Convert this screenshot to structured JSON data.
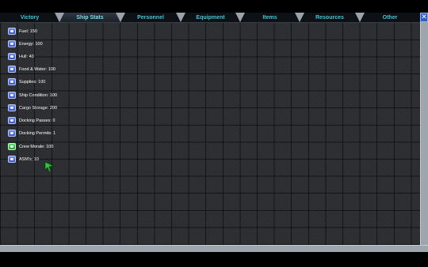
{
  "tabs": [
    {
      "label": "Victory",
      "active": false
    },
    {
      "label": "Ship Stats",
      "active": true
    },
    {
      "label": "Personnel",
      "active": false
    },
    {
      "label": "Equipment",
      "active": false
    },
    {
      "label": "Items",
      "active": false
    },
    {
      "label": "Resources",
      "active": false
    },
    {
      "label": "Other",
      "active": false
    }
  ],
  "close_icon": "close-x-icon",
  "stats": [
    {
      "label": "Fuel: 150",
      "icon": "fuel-icon"
    },
    {
      "label": "Energy: 100",
      "icon": "energy-icon"
    },
    {
      "label": "Hull: 40",
      "icon": "hull-icon"
    },
    {
      "label": "Food & Water: 100",
      "icon": "food-water-icon"
    },
    {
      "label": "Supplies: 100",
      "icon": "supplies-icon"
    },
    {
      "label": "Ship Condition: 100",
      "icon": "ship-condition-icon"
    },
    {
      "label": "Cargo Storage: 200",
      "icon": "cargo-storage-icon"
    },
    {
      "label": "Docking Passes: 0",
      "icon": "docking-pass-icon"
    },
    {
      "label": "Docking Permits: 1",
      "icon": "docking-permit-icon"
    },
    {
      "label": "Crew Morale: 100",
      "icon": "crew-morale-icon"
    },
    {
      "label": "ASM's: 10",
      "icon": "asm-icon"
    }
  ],
  "colors": {
    "tab_text": "#46c8dc",
    "icon_blue": "#4b6be0",
    "icon_green": "#33c04a",
    "cursor": "#2ec23a"
  }
}
